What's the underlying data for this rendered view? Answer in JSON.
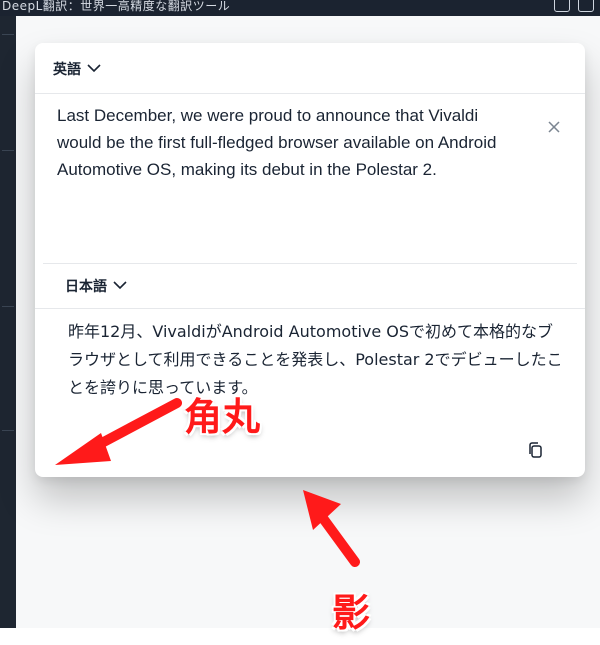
{
  "window": {
    "title": "DeepL翻訳：世界一高精度な翻訳ツール"
  },
  "source": {
    "language_label": "英語",
    "text": "Last December, we were proud to announce that Vivaldi would be the first full-fledged browser available on Android Automotive OS, making its debut in the Polestar 2.",
    "clear_icon": "close-icon"
  },
  "target": {
    "language_label": "日本語",
    "text": "昨年12月、VivaldiがAndroid Automotive OSで初めて本格的なブラウザとして利用できることを発表し、Polestar 2でデビューしたことを誇りに思っています。",
    "copy_icon": "copy-icon"
  },
  "annotations": {
    "rounded_corner_label": "角丸",
    "shadow_label": "影",
    "color": "#ff1a1a"
  }
}
